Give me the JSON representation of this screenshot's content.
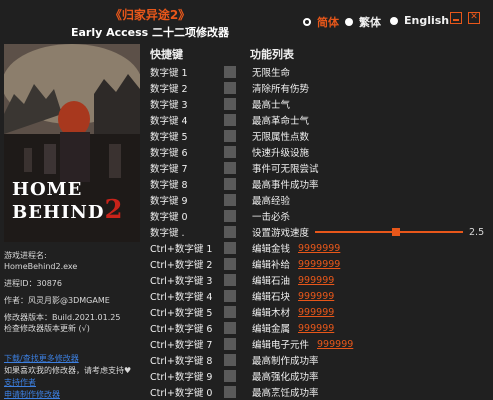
{
  "header": {
    "title": "《归家异途2》",
    "subtitle": "Early Access 二十二项修改器"
  },
  "languages": [
    {
      "label": "简体",
      "selected": true
    },
    {
      "label": "繁体",
      "selected": false
    },
    {
      "label": "English",
      "selected": false
    }
  ],
  "cover": {
    "line1": "HOME",
    "line2": "BEHIND",
    "num": "2"
  },
  "info": {
    "process_label": "游戏进程名:",
    "process_name": "HomeBehind2.exe",
    "pid": "进程ID：30876",
    "author": "作者：风灵月影@3DMGAME",
    "version": "修改器版本：Build.2021.01.25",
    "update": "检查修改器版本更新 (√)"
  },
  "links": {
    "download": "下载/查找更多修改器",
    "support_text": "如果喜欢我的修改器，请考虑支持♥",
    "support": "支持作者",
    "request": "申请制作修改器"
  },
  "table": {
    "col_hotkey": "快捷键",
    "col_function": "功能列表",
    "rows": [
      {
        "key": "数字键 1",
        "name": "无限生命"
      },
      {
        "key": "数字键 2",
        "name": "清除所有伤势"
      },
      {
        "key": "数字键 3",
        "name": "最高士气"
      },
      {
        "key": "数字键 4",
        "name": "最高革命士气"
      },
      {
        "key": "数字键 5",
        "name": "无限属性点数"
      },
      {
        "key": "数字键 6",
        "name": "快速升级设施"
      },
      {
        "key": "数字键 7",
        "name": "事件可无限尝试"
      },
      {
        "key": "数字键 8",
        "name": "最高事件成功率"
      },
      {
        "key": "数字键 9",
        "name": "最高经验"
      },
      {
        "key": "数字键 0",
        "name": "一击必杀"
      }
    ],
    "speed": {
      "key": "数字键 .",
      "name": "设置游戏速度",
      "value": "2.5",
      "fraction": 0.55
    },
    "ctrl_rows": [
      {
        "key": "Ctrl+数字键 1",
        "name": "编辑金钱",
        "value": "9999999"
      },
      {
        "key": "Ctrl+数字键 2",
        "name": "编辑补给",
        "value": "9999999"
      },
      {
        "key": "Ctrl+数字键 3",
        "name": "编辑石油",
        "value": "999999"
      },
      {
        "key": "Ctrl+数字键 4",
        "name": "编辑石块",
        "value": "999999"
      },
      {
        "key": "Ctrl+数字键 5",
        "name": "编辑木材",
        "value": "999999"
      },
      {
        "key": "Ctrl+数字键 6",
        "name": "编辑金属",
        "value": "999999"
      },
      {
        "key": "Ctrl+数字键 7",
        "name": "编辑电子元件",
        "value": "999999"
      },
      {
        "key": "Ctrl+数字键 8",
        "name": "最高制作成功率",
        "value": ""
      },
      {
        "key": "Ctrl+数字键 9",
        "name": "最高强化成功率",
        "value": ""
      },
      {
        "key": "Ctrl+数字键 0",
        "name": "最高烹饪成功率",
        "value": ""
      }
    ]
  }
}
